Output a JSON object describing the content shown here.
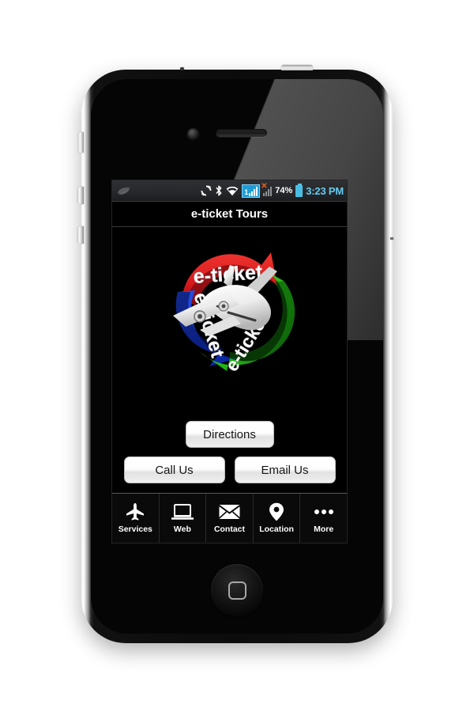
{
  "device": {
    "type": "smartphone-mockup",
    "hardware": {
      "front_camera": "front-camera",
      "earpiece": "earpiece-speaker",
      "home_button": "home-button",
      "mute_switch": "mute-switch",
      "volume_up": "volume-up-button",
      "volume_down": "volume-down-button",
      "power": "power-button"
    }
  },
  "status_bar": {
    "left_icons": [
      "leaf-icon"
    ],
    "right_icons": [
      "sync-icon",
      "bluetooth-icon",
      "wifi-icon"
    ],
    "sim_badge": {
      "number": "1",
      "icon": "signal-bars-icon",
      "highlight_color": "#1f9cd6"
    },
    "no_service": {
      "icon": "signal-bars-no-service-icon",
      "marker": "✕",
      "marker_color": "#e8601f"
    },
    "battery_percent": "74%",
    "battery_icon": "battery-icon",
    "battery_color": "#47bde3",
    "clock": "3:23 PM",
    "clock_color": "#67c9ee",
    "background_color": "#26282b"
  },
  "title_bar": {
    "title": "e-ticket Tours",
    "background_color": "#000000",
    "text_color": "#ffffff"
  },
  "logo": {
    "name": "e-ticket-tours-logo",
    "alt": "Three 3D arrows in a circle reading e-ticket with a white airplane",
    "words": [
      "e-ticket",
      "e-ticket",
      "e-ticket"
    ],
    "arrow_colors": [
      "#d5191d",
      "#1133cc",
      "#22b414"
    ],
    "plane_color": "#f2f2f2",
    "background_color": "#000000"
  },
  "actions": {
    "directions": "Directions",
    "call": "Call Us",
    "email": "Email Us"
  },
  "tab_bar": {
    "background_color": "#0a0a0a",
    "items": [
      {
        "label": "Services",
        "icon": "airplane-icon"
      },
      {
        "label": "Web",
        "icon": "laptop-icon"
      },
      {
        "label": "Contact",
        "icon": "envelope-icon"
      },
      {
        "label": "Location",
        "icon": "map-pin-icon"
      },
      {
        "label": "More",
        "icon": "ellipsis-icon"
      }
    ]
  }
}
